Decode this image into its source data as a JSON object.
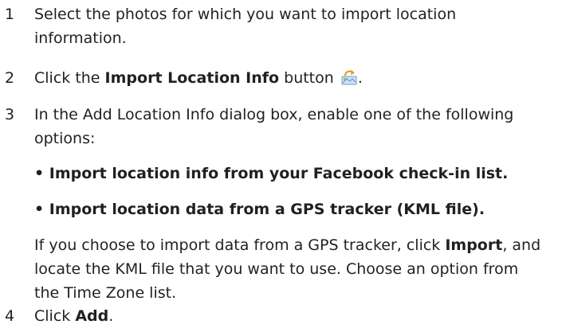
{
  "steps": [
    {
      "number": "1",
      "lines": [
        "Select the photos for which you want to import location",
        "information."
      ]
    },
    {
      "number": "2",
      "text_before": "Click the ",
      "bold": "Import Location Info",
      "text_after": " button",
      "icon": "import-location-icon",
      "end": "."
    },
    {
      "number": "3",
      "lines": [
        "In the Add Location Info dialog box, enable one of the following",
        "options:"
      ],
      "bullets": [
        "• Import location info from your Facebook check-in list.",
        "• Import location data from a GPS tracker (KML file)."
      ],
      "note": {
        "line1_before": "If you choose to import data from a GPS tracker, click ",
        "line1_bold": "Import",
        "line1_after": ", and",
        "line2": "locate the KML file that you want to use. Choose an option from",
        "line3": "the Time Zone list."
      }
    },
    {
      "number": "4",
      "text_before": "Click ",
      "bold": "Add",
      "end": "."
    }
  ],
  "colors": {
    "text": "#231f20",
    "icon_map": "#6a9bd8",
    "icon_arrow": "#e39b2b"
  }
}
